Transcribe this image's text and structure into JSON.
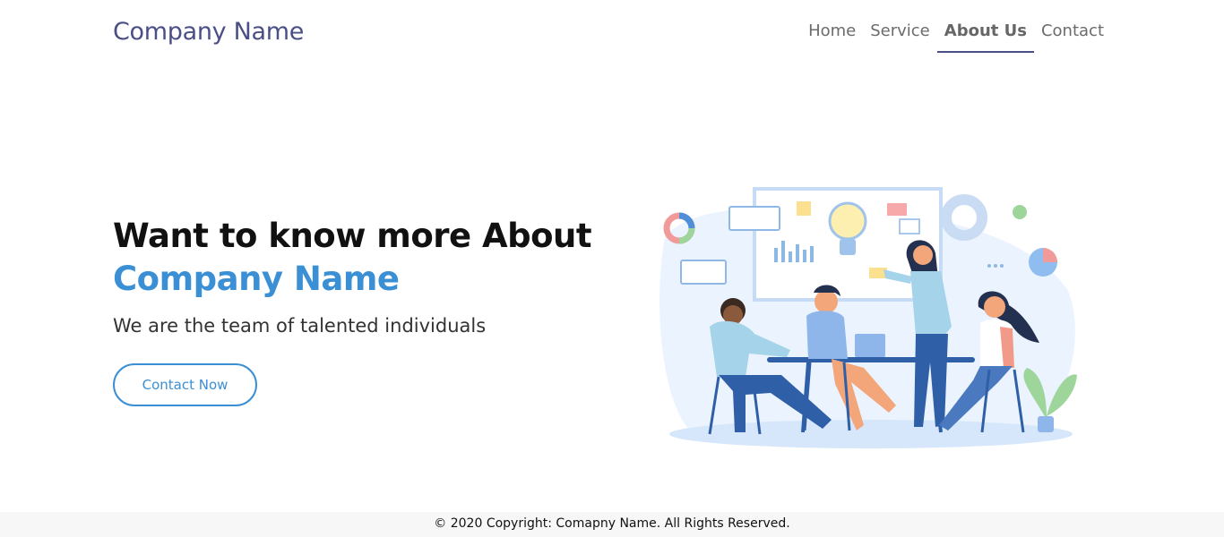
{
  "header": {
    "brand": "Company Name",
    "nav": [
      {
        "label": "Home",
        "active": false
      },
      {
        "label": "Service",
        "active": false
      },
      {
        "label": "About Us",
        "active": true
      },
      {
        "label": "Contact",
        "active": false
      }
    ]
  },
  "hero": {
    "title_line1": "Want to know more About",
    "title_line2": "Company Name",
    "tagline": "We are the team of talented individuals",
    "cta_label": "Contact Now",
    "illustration": "team-meeting-illustration"
  },
  "footer": {
    "copyright": "© 2020 Copyright: Comapny Name. All Rights Reserved."
  },
  "colors": {
    "brand": "#4a4f86",
    "accent": "#3b8fd4",
    "text": "#111111"
  }
}
